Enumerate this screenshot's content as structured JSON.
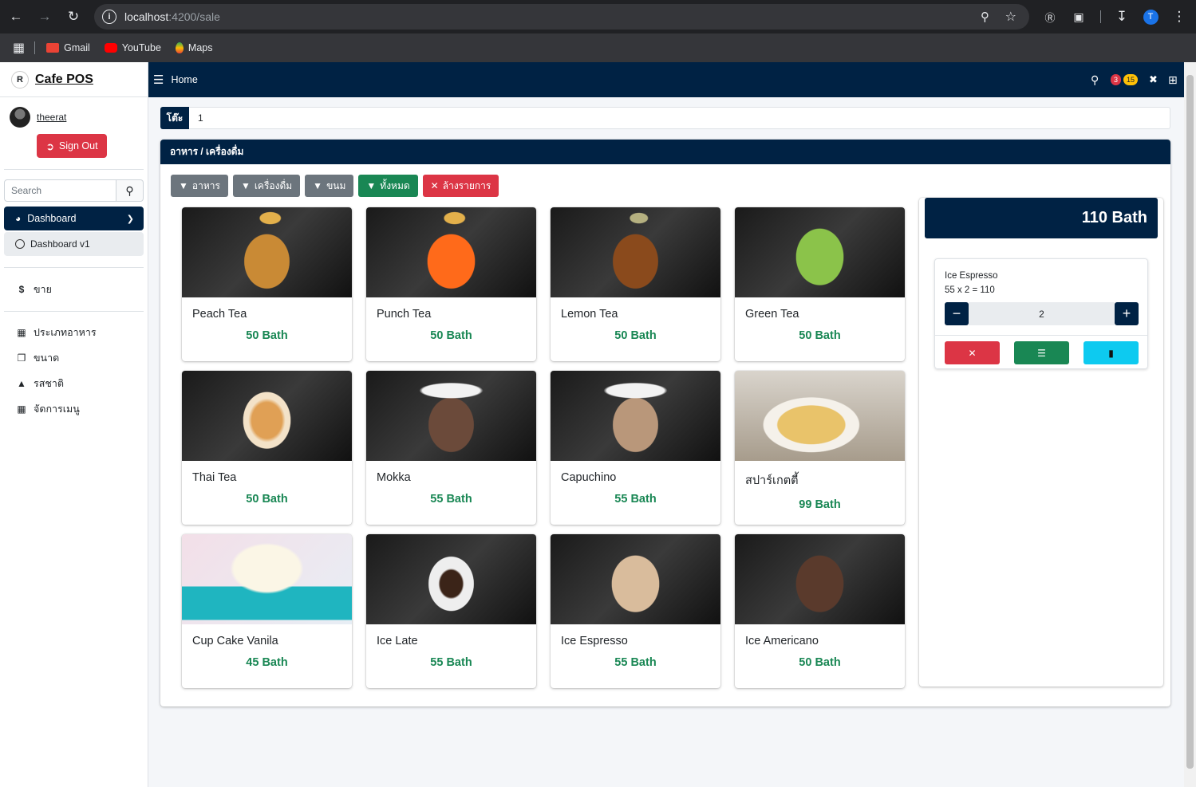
{
  "browser": {
    "url_host": "localhost",
    "url_path": ":4200/sale",
    "bookmarks": [
      "Gmail",
      "YouTube",
      "Maps"
    ],
    "profile_initial": "T"
  },
  "sidebar": {
    "brand": "Cafe POS",
    "brand_logo": "R",
    "username": "theerat",
    "signout": "Sign Out",
    "search_placeholder": "Search",
    "dashboard": "Dashboard",
    "dashboard_v1": "Dashboard v1",
    "sale": "ขาย",
    "menu_items": [
      "ประเภทอาหาร",
      "ขนาด",
      "รสชาติ",
      "จัดการเมนู"
    ]
  },
  "topnav": {
    "home": "Home",
    "badge_red": "3",
    "badge_yellow": "15"
  },
  "table": {
    "label": "โต๊ะ",
    "value": "1"
  },
  "panel": {
    "title": "อาหาร / เครื่องดื่ม",
    "filters": [
      {
        "label": "อาหาร",
        "color": "#6c757d"
      },
      {
        "label": "เครื่องดื่ม",
        "color": "#6c757d"
      },
      {
        "label": "ขนม",
        "color": "#6c757d"
      },
      {
        "label": "ทั้งหมด",
        "color": "#198754"
      },
      {
        "label": "ล้างรายการ",
        "color": "#dc3545"
      }
    ]
  },
  "products": [
    {
      "name": "Peach Tea",
      "price": "50 Bath"
    },
    {
      "name": "Punch Tea",
      "price": "50 Bath"
    },
    {
      "name": "Lemon Tea",
      "price": "50 Bath"
    },
    {
      "name": "Green Tea",
      "price": "50 Bath"
    },
    {
      "name": "Thai Tea",
      "price": "50 Bath"
    },
    {
      "name": "Mokka",
      "price": "55 Bath"
    },
    {
      "name": "Capuchino",
      "price": "55 Bath"
    },
    {
      "name": "สปาร์เกตตี้",
      "price": "99 Bath"
    },
    {
      "name": "Cup Cake Vanila",
      "price": "45 Bath"
    },
    {
      "name": "Ice Late",
      "price": "55 Bath"
    },
    {
      "name": "Ice Espresso",
      "price": "55 Bath"
    },
    {
      "name": "Ice Americano",
      "price": "50 Bath"
    }
  ],
  "cart": {
    "total": "110 Bath",
    "item_name": "Ice Espresso",
    "item_calc": "55 x 2 = 110",
    "qty": "2"
  },
  "colors": {
    "primary": "#002244",
    "success": "#198754",
    "danger": "#dc3545",
    "info": "#0dcaf0"
  }
}
